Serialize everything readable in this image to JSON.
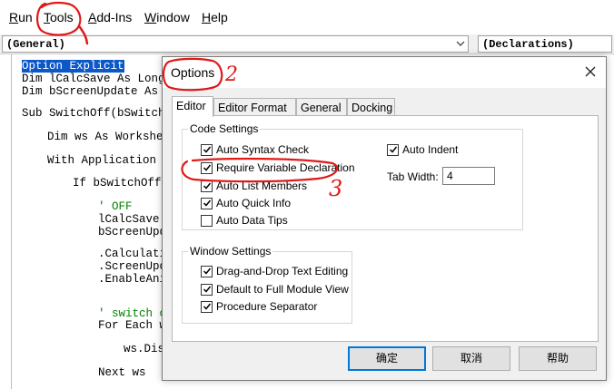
{
  "menubar": {
    "items": [
      {
        "label": "Run",
        "underline": "R",
        "rest": "un"
      },
      {
        "label": "Tools",
        "underline": "T",
        "rest": "ools"
      },
      {
        "label": "Add-Ins",
        "underline": "A",
        "rest": "dd-Ins"
      },
      {
        "label": "Window",
        "underline": "W",
        "rest": "indow"
      },
      {
        "label": "Help",
        "underline": "H",
        "rest": "elp"
      }
    ]
  },
  "module_bar": {
    "object_combo": "(General)",
    "procedure_combo": "(Declarations)"
  },
  "code": {
    "lines": [
      "Option Explicit",
      "Dim lCalcSave As Long",
      "Dim bScreenUpdate As B",
      "Sub SwitchOff(bSwitchO",
      "Dim ws As Workshee",
      "With Application",
      "If bSwitchOff",
      "' OFF",
      "lCalcSave",
      "bScreenUpd",
      ".Calculati",
      ".ScreenUpd",
      ".EnableAni",
      "' switch o",
      "For Each w",
      "ws.Dis",
      "Next ws"
    ]
  },
  "dialog": {
    "title": "Options",
    "tabs": [
      "Editor",
      "Editor Format",
      "General",
      "Docking"
    ],
    "code_settings": {
      "title": "Code Settings",
      "options": [
        {
          "label": "Auto Syntax Check",
          "checked": true
        },
        {
          "label": "Require Variable Declaration",
          "checked": true
        },
        {
          "label": "Auto List Members",
          "checked": true
        },
        {
          "label": "Auto Quick Info",
          "checked": true
        },
        {
          "label": "Auto Data Tips",
          "checked": false
        }
      ],
      "auto_indent": {
        "label": "Auto Indent",
        "checked": true
      },
      "tab_width": {
        "label": "Tab Width:",
        "value": "4"
      }
    },
    "window_settings": {
      "title": "Window Settings",
      "options": [
        {
          "label": "Drag-and-Drop Text Editing",
          "checked": true
        },
        {
          "label": "Default to Full Module View",
          "checked": true
        },
        {
          "label": "Procedure Separator",
          "checked": true
        }
      ]
    },
    "buttons": {
      "ok": "确定",
      "cancel": "取消",
      "help": "帮助"
    }
  },
  "annotations": {
    "step2": "2",
    "step3": "3"
  },
  "colors": {
    "annotation": "#e01818",
    "selection": "#0b58c8",
    "comment": "#008000",
    "default_button_border": "#0078d7"
  }
}
